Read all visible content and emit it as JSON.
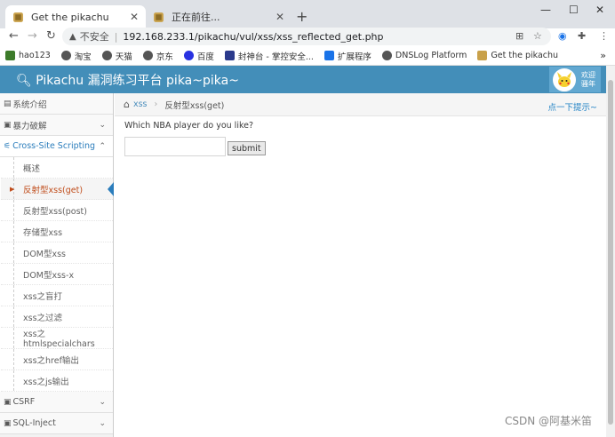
{
  "browser": {
    "tabs": [
      {
        "title": "Get the pikachu",
        "active": true
      },
      {
        "title": "正在前往...",
        "active": false
      }
    ],
    "new_tab": "+",
    "url_security": "不安全",
    "url_separator": "|",
    "url": "192.168.233.1/pikachu/vul/xss/xss_reflected_get.php",
    "bookmarks": [
      {
        "label": "hao123",
        "color": "#3d7b2a"
      },
      {
        "label": "淘宝",
        "color": "#555555"
      },
      {
        "label": "天猫",
        "color": "#555555"
      },
      {
        "label": "京东",
        "color": "#555555"
      },
      {
        "label": "百度",
        "color": "#2932e1"
      },
      {
        "label": "封神台 - 掌控安全...",
        "color": "#2b3a8c"
      },
      {
        "label": "扩展程序",
        "color": "#1a73e8"
      },
      {
        "label": "DNSLog Platform",
        "color": "#555555"
      },
      {
        "label": "Get the pikachu",
        "color": "#c9a14a"
      }
    ],
    "bookmarks_more": "»"
  },
  "site": {
    "title": "Pikachu 漏洞练习平台 pika~pika~",
    "welcome": [
      "欢迎",
      "骚年"
    ],
    "accent": "#438eb9"
  },
  "sidebar": {
    "top_items": [
      {
        "label": "系统介绍"
      },
      {
        "label": "暴力破解"
      }
    ],
    "open_item": {
      "label": "Cross-Site Scripting"
    },
    "sub_items": [
      {
        "label": "概述",
        "active": false
      },
      {
        "label": "反射型xss(get)",
        "active": true
      },
      {
        "label": "反射型xss(post)",
        "active": false
      },
      {
        "label": "存储型xss",
        "active": false
      },
      {
        "label": "DOM型xss",
        "active": false
      },
      {
        "label": "DOM型xss-x",
        "active": false
      },
      {
        "label": "xss之盲打",
        "active": false
      },
      {
        "label": "xss之过滤",
        "active": false
      },
      {
        "label": "xss之htmlspecialchars",
        "active": false
      },
      {
        "label": "xss之href输出",
        "active": false
      },
      {
        "label": "xss之js输出",
        "active": false
      }
    ],
    "bottom_items": [
      {
        "label": "CSRF"
      },
      {
        "label": "SQL-Inject"
      }
    ]
  },
  "breadcrumbs": {
    "link": "xss",
    "separator": "›",
    "current": "反射型xss(get)",
    "hint": "点一下提示~"
  },
  "main": {
    "question": "Which NBA player do you like?",
    "input_value": "",
    "submit_label": "submit"
  },
  "watermark": "CSDN @阿基米笛"
}
